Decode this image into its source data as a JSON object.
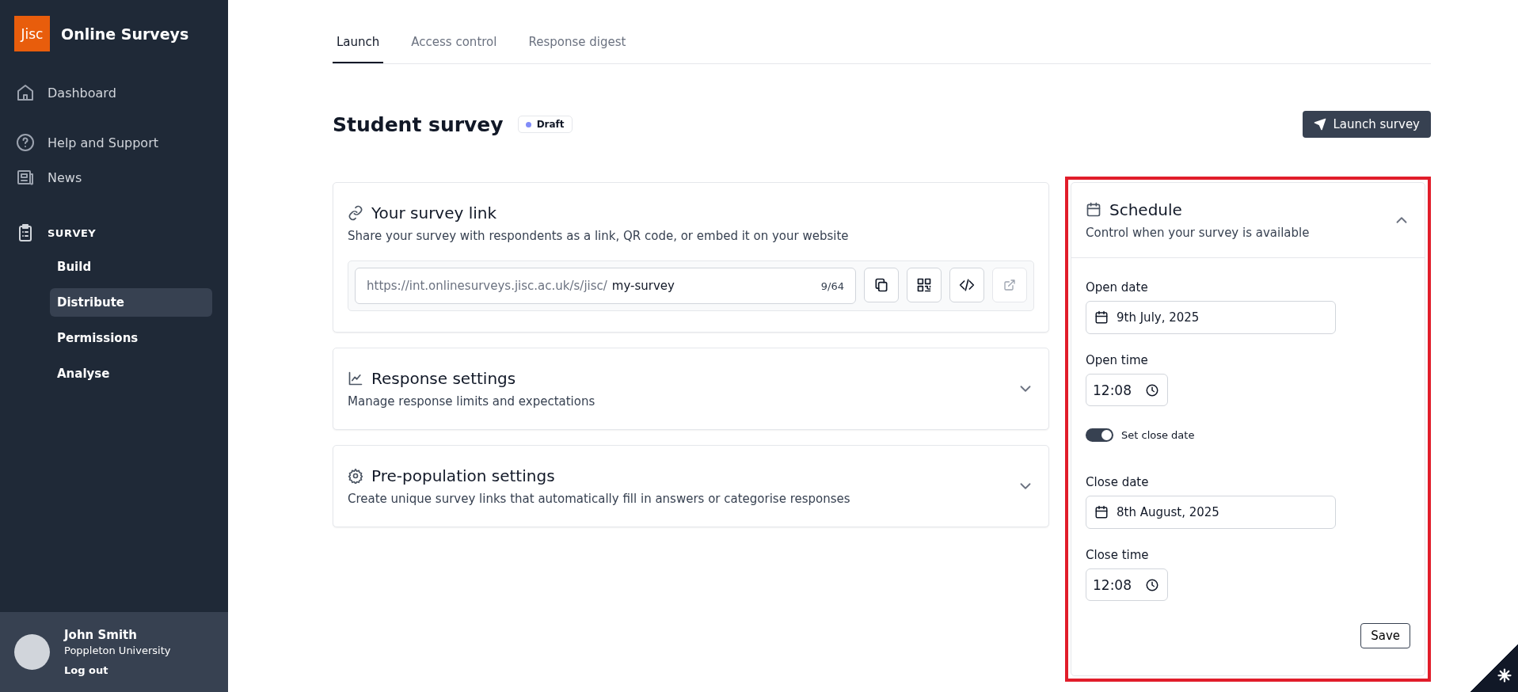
{
  "sidebar": {
    "logo": "Jisc",
    "app_name": "Online Surveys",
    "items": [
      {
        "label": "Dashboard",
        "kind": "home"
      },
      {
        "label": "Help and Support",
        "kind": "help"
      },
      {
        "label": "News",
        "kind": "news"
      }
    ],
    "section": {
      "label": "SURVEY",
      "children": [
        {
          "label": "Build",
          "selected": false
        },
        {
          "label": "Distribute",
          "selected": true
        },
        {
          "label": "Permissions",
          "selected": false
        },
        {
          "label": "Analyse",
          "selected": false
        }
      ]
    },
    "user": {
      "name": "John Smith",
      "organisation": "Poppleton University",
      "logout": "Log out"
    }
  },
  "tabs": [
    {
      "label": "Launch",
      "selected": true
    },
    {
      "label": "Access control",
      "selected": false
    },
    {
      "label": "Response digest",
      "selected": false
    }
  ],
  "page": {
    "title": "Student survey",
    "status": "Draft",
    "launch_button": "Launch survey"
  },
  "cards": [
    {
      "kind": "link",
      "title": "Your survey link",
      "description": "Share your survey with respondents as a link, QR code, or embed it on your website",
      "url_prefix": "https://int.onlinesurveys.jisc.ac.uk/s/jisc/",
      "slug": "my-survey",
      "counter": "9/64"
    },
    {
      "kind": "chart",
      "title": "Response settings",
      "description": "Manage response limits and expectations",
      "expanded": false
    },
    {
      "kind": "gear",
      "title": "Pre-population settings",
      "description": "Create unique survey links that automatically fill in answers or categorise responses",
      "expanded": false
    }
  ],
  "schedule": {
    "title": "Schedule",
    "description": "Control when your survey is available",
    "expanded": true,
    "open_date": {
      "label": "Open date",
      "value": "9th July, 2025"
    },
    "open_time": {
      "label": "Open time",
      "value": "12:08"
    },
    "close_toggle": {
      "label": "Set close date",
      "on": true
    },
    "close_date": {
      "label": "Close date",
      "value": "8th August, 2025"
    },
    "close_time": {
      "label": "Close time",
      "value": "12:08"
    },
    "save_button": "Save"
  }
}
